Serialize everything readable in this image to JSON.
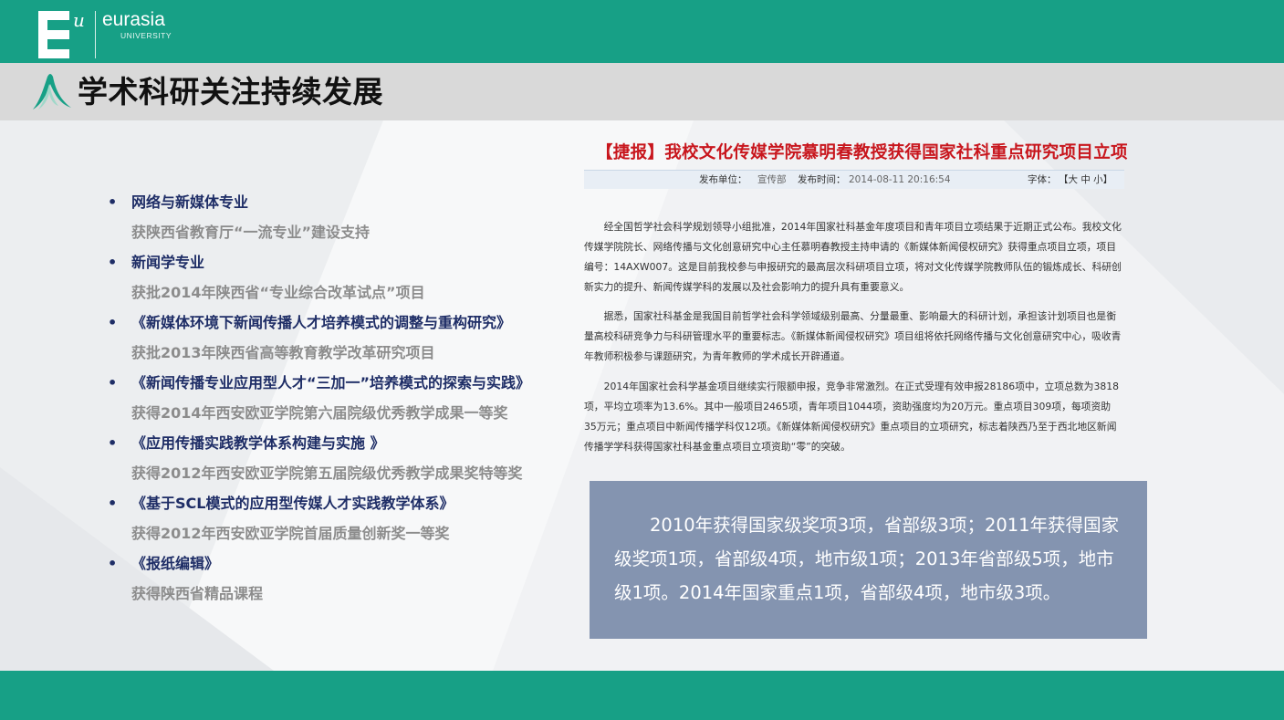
{
  "brand": {
    "logo_sup": "u",
    "name": "eurasia",
    "sub": "UNIVERSITY",
    "accent_color": "#17a086",
    "title_bar_color": "#d9d9d9"
  },
  "page_title": "学术科研关注持续发展",
  "list_items": [
    {
      "title": "网络与新媒体专业",
      "sub": "获陕西省教育厅“一流专业”建设支持"
    },
    {
      "title": "新闻学专业",
      "sub": "获批2014年陕西省“专业综合改革试点”项目"
    },
    {
      "title": "《新媒体环境下新闻传播人才培养模式的调整与重构研究》",
      "sub": "获批2013年陕西省高等教育教学改革研究项目"
    },
    {
      "title": "《新闻传播专业应用型人才“三加一”培养模式的探索与实践》",
      "sub": "获得2014年西安欧亚学院第六届院级优秀教学成果一等奖"
    },
    {
      "title": "《应用传播实践教学体系构建与实施 》",
      "sub": "获得2012年西安欧亚学院第五届院级优秀教学成果奖特等奖"
    },
    {
      "title": "《基于SCL模式的应用型传媒人才实践教学体系》",
      "sub": "获得2012年西安欧亚学院首届质量创新奖一等奖"
    },
    {
      "title": "《报纸编辑》",
      "sub": "获得陕西省精品课程"
    }
  ],
  "article": {
    "title": "【捷报】我校文化传媒学院慕明春教授获得国家社科重点研究项目立项",
    "publisher_label": "发布单位：",
    "publisher": "宣传部",
    "time_label": "发布时间：",
    "time": "2014-08-11 20:16:54",
    "font_label": "字体：",
    "font_sizes": "【大 中 小】",
    "paragraphs": [
      "经全国哲学社会科学规划领导小组批准，2014年国家社科基金年度项目和青年项目立项结果于近期正式公布。我校文化传媒学院院长、网络传播与文化创意研究中心主任慕明春教授主持申请的《新媒体新闻侵权研究》获得重点项目立项，项目编号：14AXW007。这是目前我校参与申报研究的最高层次科研项目立项，将对文化传媒学院教师队伍的锻炼成长、科研创新实力的提升、新闻传媒学科的发展以及社会影响力的提升具有重要意义。",
      "据悉，国家社科基金是我国目前哲学社会科学领域级别最高、分量最重、影响最大的科研计划，承担该计划项目也是衡量高校科研竞争力与科研管理水平的重要标志。《新媒体新闻侵权研究》项目组将依托网络传播与文化创意研究中心，吸收青年教师积极参与课题研究，为青年教师的学术成长开辟通道。",
      "2014年国家社会科学基金项目继续实行限额申报，竞争非常激烈。在正式受理有效申报28186项中，立项总数为3818项，平均立项率为13.6%。其中一般项目2465项，青年项目1044项，资助强度均为20万元。重点项目309项，每项资助35万元；重点项目中新闻传播学科仅12项。《新媒体新闻侵权研究》重点项目的立项研究，标志着陕西乃至于西北地区新闻传播学学科获得国家社科基金重点项目立项资助“零”的突破。"
    ]
  },
  "infobox": {
    "text": "2010年获得国家级奖项3项，省部级3项；2011年获得国家级奖项1项，省部级4项，地市级1项；2013年省部级5项，地市级1项。2014年国家重点1项，省部级4项，地市级3项。",
    "color": "#8494b0"
  }
}
